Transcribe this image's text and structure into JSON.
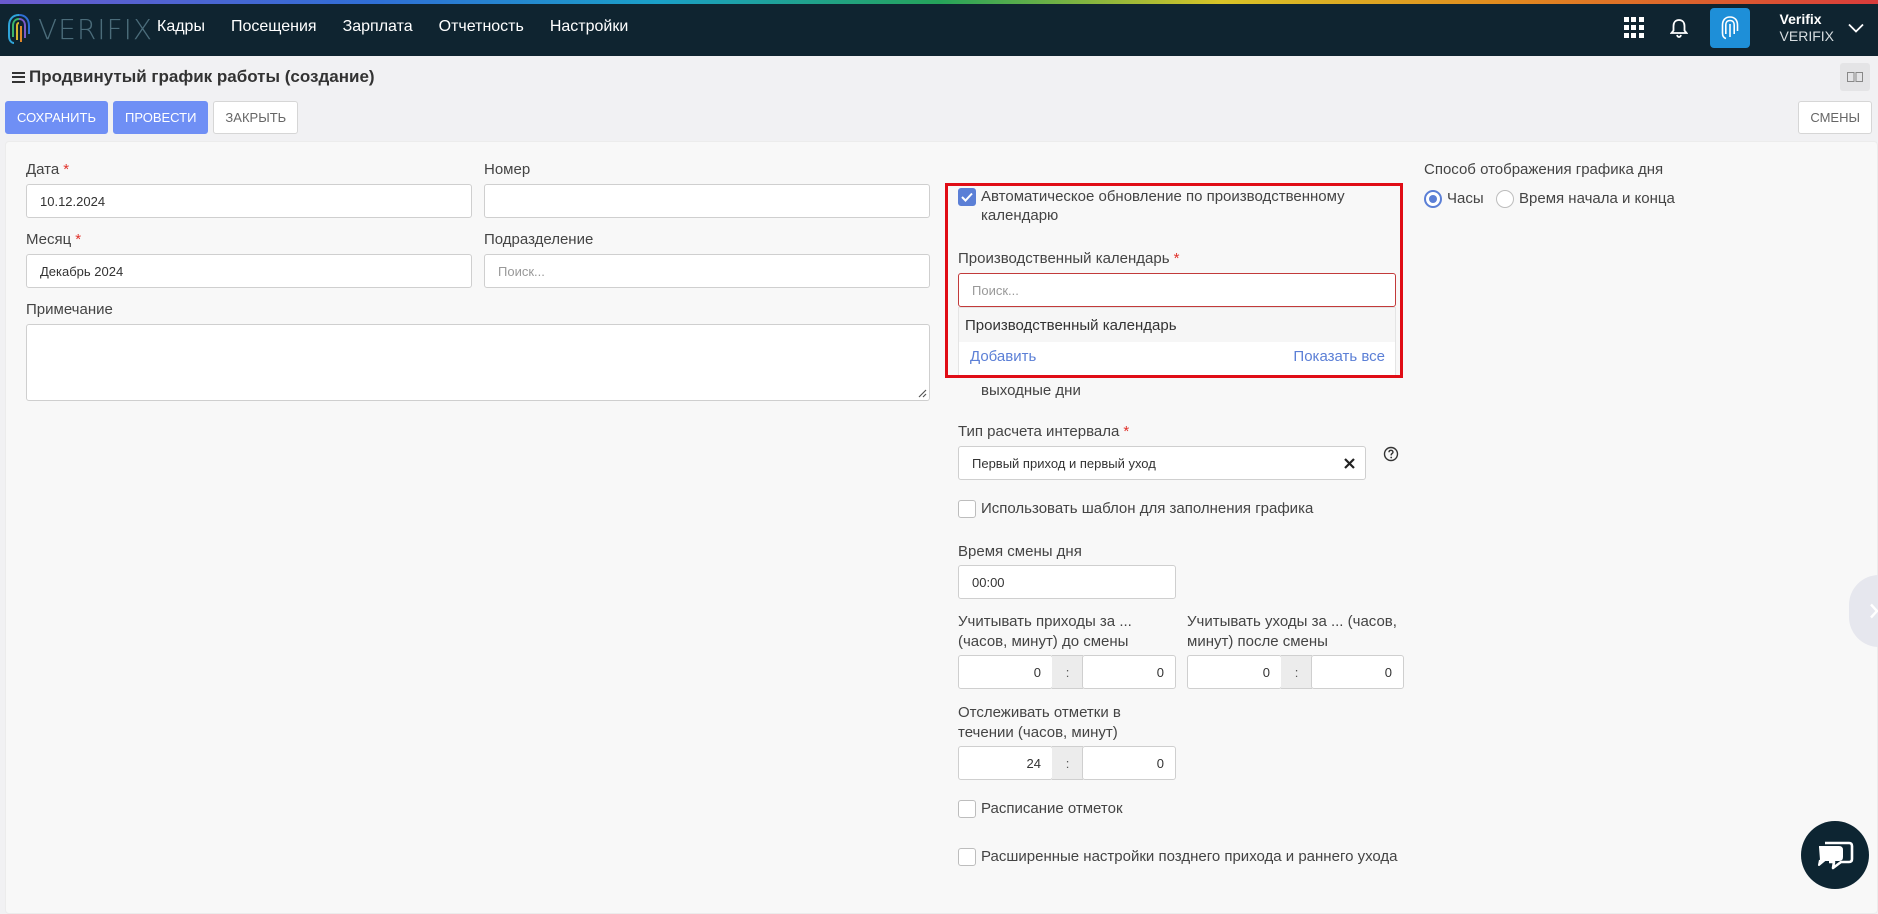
{
  "header": {
    "logo_text": "VERIFIX",
    "nav": [
      "Кадры",
      "Посещения",
      "Зарплата",
      "Отчетность",
      "Настройки"
    ],
    "user_name": "Verifix",
    "user_org": "VERIFIX"
  },
  "page": {
    "title": "Продвинутый график работы (создание)"
  },
  "toolbar": {
    "save": "СОХРАНИТЬ",
    "post": "ПРОВЕСТИ",
    "close": "ЗАКРЫТЬ",
    "shifts": "СМЕНЫ"
  },
  "form": {
    "date_label": "Дата",
    "date_value": "10.12.2024",
    "number_label": "Номер",
    "number_value": "",
    "month_label": "Месяц",
    "month_value": "Декабрь 2024",
    "division_label": "Подразделение",
    "division_placeholder": "Поиск...",
    "note_label": "Примечание",
    "required_mark": "*"
  },
  "calendar": {
    "auto_update_label": "Автоматическое обновление по производственному календарю",
    "auto_update_checked": true,
    "prod_calendar_label": "Производственный календарь",
    "search_placeholder": "Поиск...",
    "dropdown_item": "Производственный календарь",
    "add_link": "Добавить",
    "show_all_link": "Показать все",
    "weekends_label": "выходные дни"
  },
  "interval": {
    "label": "Тип расчета интервала",
    "value": "Первый приход и первый уход",
    "use_template_label": "Использовать шаблон для заполнения графика",
    "day_change_label": "Время смены дня",
    "day_change_value": "00:00",
    "arrivals_label": "Учитывать приходы за ... (часов, минут) до смены",
    "arrivals_hours": "0",
    "arrivals_minutes": "0",
    "departures_label": "Учитывать уходы за ... (часов, минут) после смены",
    "departures_hours": "0",
    "departures_minutes": "0",
    "track_label": "Отслеживать отметки в течении (часов, минут)",
    "track_hours": "24",
    "track_minutes": "0",
    "colon": ":",
    "marks_schedule_label": "Расписание отметок",
    "advanced_label": "Расширенные настройки позднего прихода и раннего ухода"
  },
  "display": {
    "label": "Способ отображения графика дня",
    "option_hours": "Часы",
    "option_start_end": "Время начала и конца",
    "selected": "Часы"
  }
}
